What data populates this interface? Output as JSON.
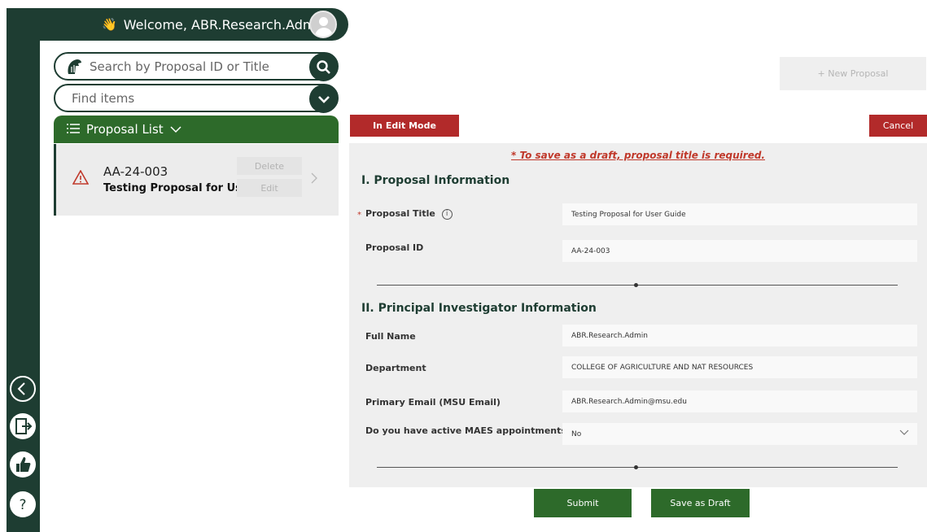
{
  "header": {
    "welcome_text": "Welcome, ABR.Research.Admin",
    "wave_icon": "wave-hand-icon",
    "avatar_icon": "user-avatar-icon"
  },
  "search": {
    "placeholder": "Search by Proposal ID or Title",
    "find_placeholder": "Find items"
  },
  "proposal_list": {
    "header_label": "Proposal List",
    "items": [
      {
        "id": "AA-24-003",
        "title": "Testing Proposal for User",
        "delete_label": "Delete",
        "edit_label": "Edit"
      }
    ]
  },
  "actions": {
    "new_proposal": "+ New Proposal",
    "edit_mode": "In Edit Mode",
    "cancel": "Cancel",
    "submit": "Submit",
    "save_draft": "Save as Draft"
  },
  "form": {
    "draft_note": "* To save as a draft, proposal title is required.",
    "section1": "I. Proposal Information",
    "section2": "II. Principal Investigator Information",
    "required_mark": "*",
    "info_glyph": "i",
    "fields": {
      "proposal_title": {
        "label": "Proposal Title",
        "value": "Testing Proposal for User Guide"
      },
      "proposal_id": {
        "label": "Proposal ID",
        "value": "AA-24-003"
      },
      "full_name": {
        "label": "Full Name",
        "value": "ABR.Research.Admin"
      },
      "department": {
        "label": "Department",
        "value": "COLLEGE OF AGRICULTURE AND NAT RESOURCES"
      },
      "email": {
        "label": "Primary Email (MSU Email)",
        "value": "ABR.Research.Admin@msu.edu"
      },
      "maes": {
        "label": "Do you have active MAES appointments?",
        "value": "No"
      }
    }
  },
  "colors": {
    "dark_green": "#1e3d32",
    "green": "#2d6a2a",
    "red": "#b22a2a"
  }
}
